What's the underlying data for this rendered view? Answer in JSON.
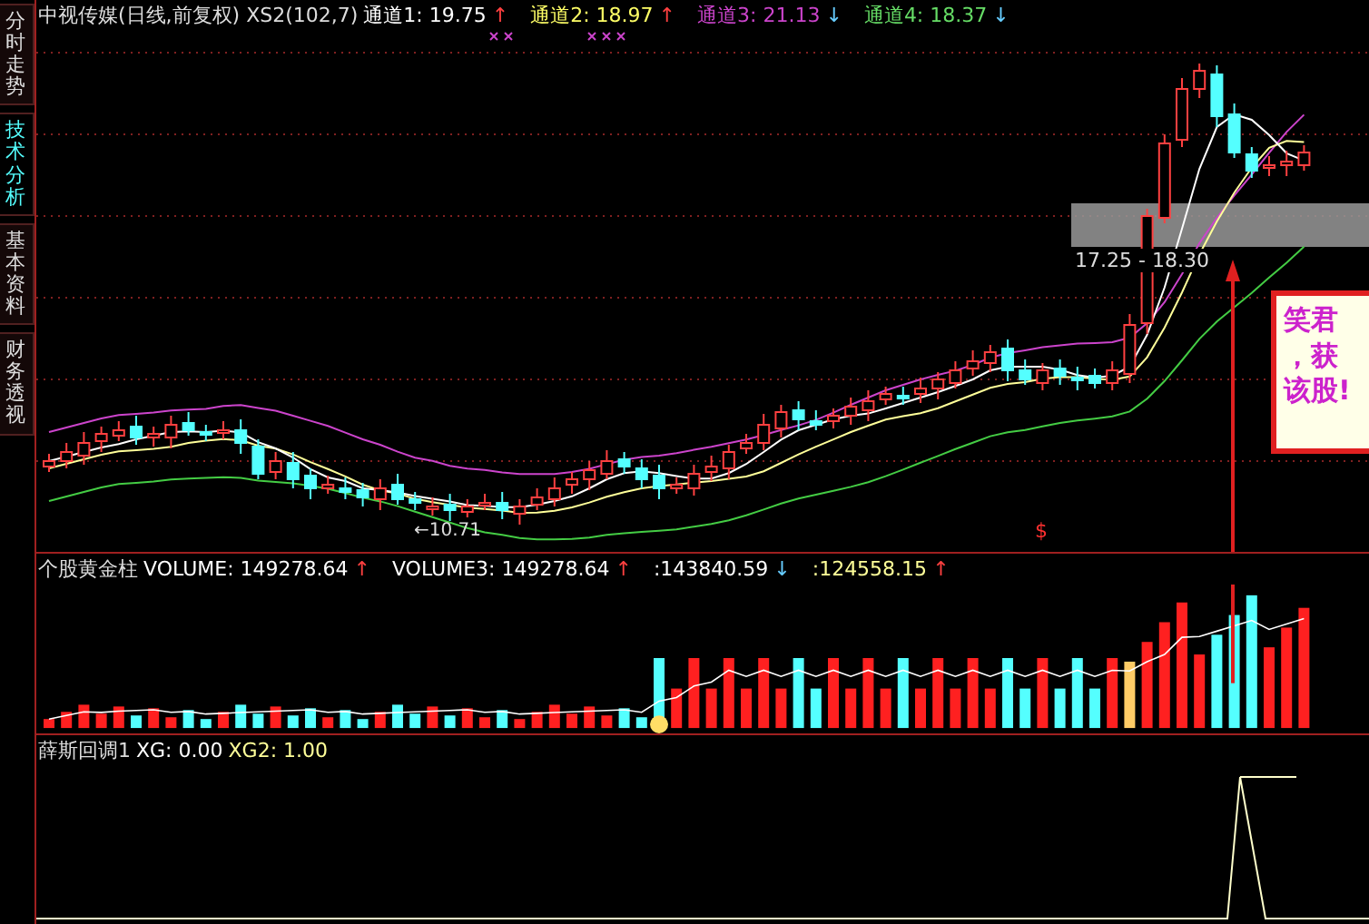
{
  "sidebar": {
    "tabs": [
      {
        "label": "分时走势",
        "selected": false
      },
      {
        "label": "技术分析",
        "selected": true
      },
      {
        "label": "基本资料",
        "selected": false
      },
      {
        "label": "财务透视",
        "selected": false
      }
    ]
  },
  "price_panel": {
    "title": "中视传媒(日线,前复权) XS2(102,7)",
    "readings": [
      {
        "label": "通道1: 19.75",
        "arrow": {
          "text": "↑",
          "color": "#ff4040"
        },
        "color": "#ffffff"
      },
      {
        "label": "通道2: 18.97",
        "arrow": {
          "text": "↑",
          "color": "#ff4040"
        },
        "color": "#ffff66"
      },
      {
        "label": "通道3: 21.13",
        "arrow": {
          "text": "↓",
          "color": "#66ccff"
        },
        "color": "#cc44cc"
      },
      {
        "label": "通道4: 18.37",
        "arrow": {
          "text": "↓",
          "color": "#66ccff"
        },
        "color": "#66dd66"
      }
    ],
    "low_label": "←10.71",
    "range_label": "17.25 - 18.30",
    "signal_mark": "$",
    "note_lines": [
      "笑君",
      "，获",
      "该股!"
    ]
  },
  "volume_panel": {
    "title": "个股黄金柱",
    "readings": [
      {
        "label": "VOLUME: 149278.64",
        "arrow": {
          "text": "↑",
          "color": "#ff4040"
        },
        "color": "#ffffff"
      },
      {
        "label": "VOLUME3: 149278.64",
        "arrow": {
          "text": "↑",
          "color": "#ff4040"
        },
        "color": "#ffffff"
      },
      {
        "label": ":143840.59",
        "arrow": {
          "text": "↓",
          "color": "#66ccff"
        },
        "color": "#ffffff"
      },
      {
        "label": ":124558.15",
        "arrow": {
          "text": "↑",
          "color": "#ff4040"
        },
        "color": "#ffff99"
      }
    ]
  },
  "indicator_panel": {
    "title": "薛斯回调1",
    "readings": [
      {
        "label": "XG: 0.00",
        "color": "#ffffff"
      },
      {
        "label": "XG2: 1.00",
        "color": "#ffff99"
      }
    ]
  }
}
